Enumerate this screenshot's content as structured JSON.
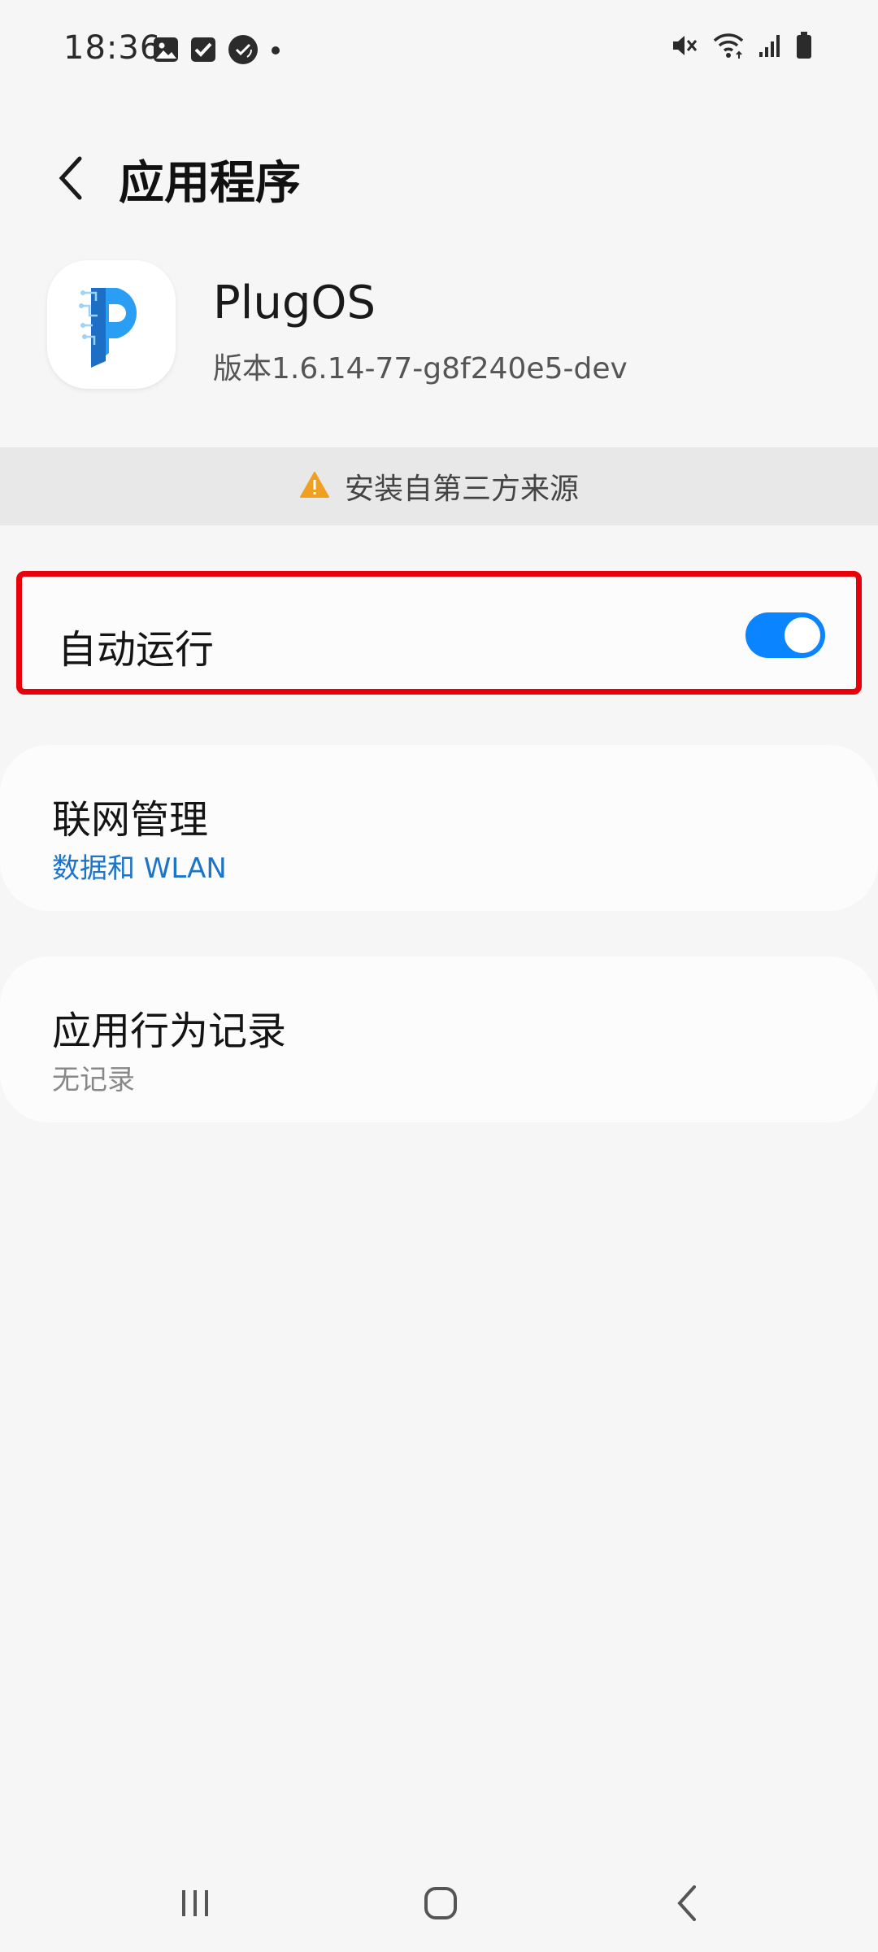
{
  "status_bar": {
    "time": "18:36",
    "left_icons": [
      "gallery-icon",
      "checkbox-icon",
      "sync-app-icon",
      "dot-icon"
    ],
    "right_icons": [
      "mute-icon",
      "wifi-icon",
      "signal-icon",
      "battery-icon"
    ]
  },
  "header": {
    "title": "应用程序"
  },
  "app": {
    "name": "PlugOS",
    "version": "版本1.6.14-77-g8f240e5-dev",
    "icon": "plugos-logo"
  },
  "warning": {
    "text": "安装自第三方来源",
    "icon": "warning-triangle-icon",
    "color": "#f0a020"
  },
  "autorun": {
    "label": "自动运行",
    "enabled": true,
    "toggle_color": "#0a84ff",
    "highlight_color": "#e8000a"
  },
  "network": {
    "title": "联网管理",
    "subtitle": "数据和 WLAN",
    "subtitle_color": "#1b74c9"
  },
  "history": {
    "title": "应用行为记录",
    "subtitle": "无记录"
  },
  "nav": {
    "buttons": [
      "recents-icon",
      "home-icon",
      "back-icon"
    ]
  }
}
